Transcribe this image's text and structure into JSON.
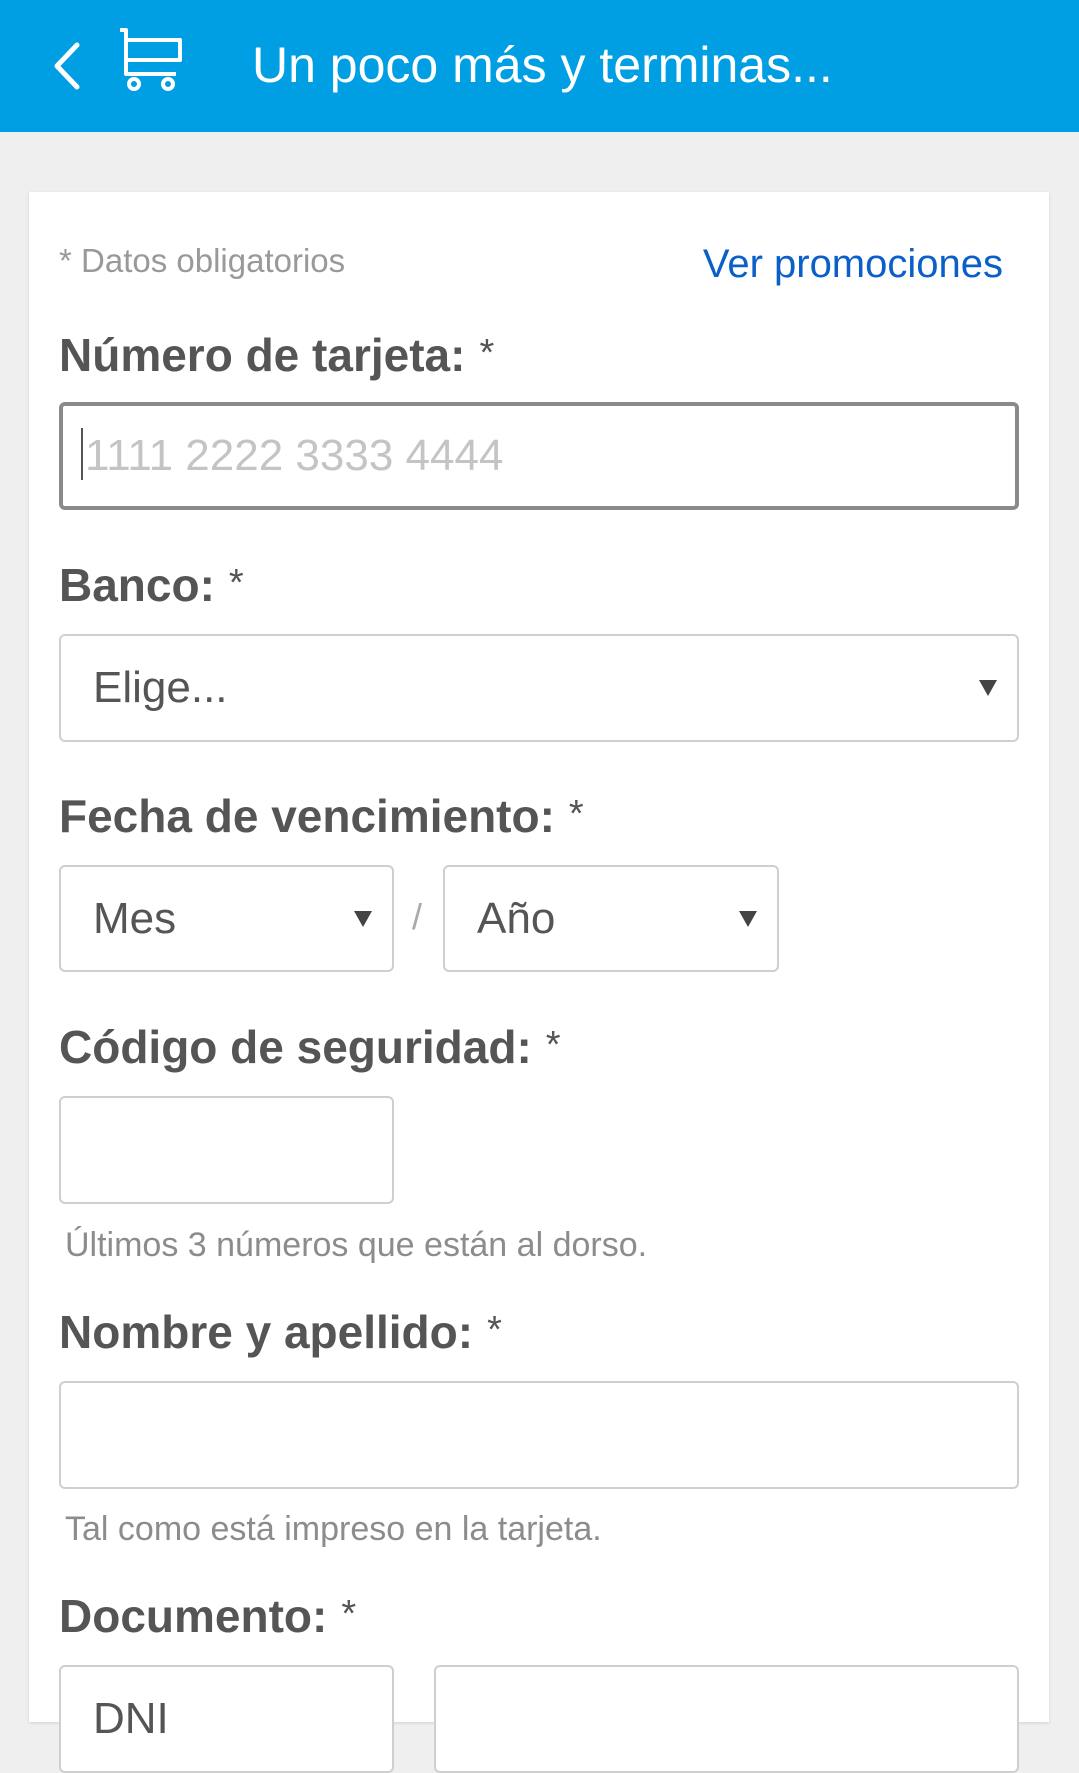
{
  "appbar": {
    "back_icon": "chevron-left-icon",
    "cart_icon": "shopping-cart-icon",
    "title": "Un poco más y terminas...",
    "color": "#009ee3"
  },
  "form": {
    "required_note": "* Datos obligatorios",
    "promo_link": "Ver promociones",
    "required_mark": "*",
    "card_number": {
      "label": "Número de tarjeta:",
      "placeholder": "1111 2222 3333 4444",
      "value": ""
    },
    "bank": {
      "label": "Banco:",
      "selected": "Elige..."
    },
    "expiry": {
      "label": "Fecha de vencimiento:",
      "month_selected": "Mes",
      "separator": "/",
      "year_selected": "Año"
    },
    "security_code": {
      "label": "Código de seguridad:",
      "value": "",
      "hint": "Últimos 3 números que están al dorso."
    },
    "full_name": {
      "label": "Nombre y apellido:",
      "value": "",
      "hint": "Tal como está impreso en la tarjeta."
    },
    "document": {
      "label": "Documento:",
      "type_selected": "DNI",
      "number": ""
    }
  }
}
